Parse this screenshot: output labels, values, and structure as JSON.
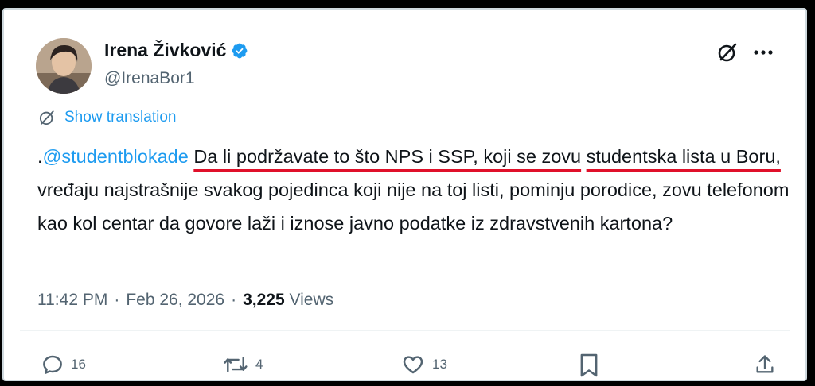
{
  "author": {
    "display_name": "Irena Živković",
    "handle": "@IrenaBor1",
    "verified": true
  },
  "icons": {
    "avatar": "profile-photo",
    "verified": "verified-badge-icon",
    "grok": "grok-icon",
    "more": "more-icon",
    "translate": "translate-icon"
  },
  "translation": {
    "label": "Show translation"
  },
  "tweet": {
    "prefix": ".",
    "mention": "@studentblokade",
    "seg1": " ",
    "u1": "Da li podržavate to što NPS i SSP, koji se zovu",
    "seg2": " ",
    "u2": "studentska lista u Boru,",
    "seg3": " vređaju najstrašnije svakog pojedinca koji nije na toj listi, pominju porodice, zovu telefonom kao kol centar da govore laži i iznose javno podatke iz zdravstvenih kartona?"
  },
  "meta": {
    "time": "11:42 PM",
    "sep1": "·",
    "date": "Feb 26, 2026",
    "sep2": "·",
    "views_count": "3,225",
    "views_label": "Views"
  },
  "actions": {
    "replies": "16",
    "reposts": "4",
    "likes": "13"
  },
  "colors": {
    "accent": "#1d9bf0",
    "text": "#0f1419",
    "secondary": "#536471",
    "underline": "#e0102a"
  }
}
